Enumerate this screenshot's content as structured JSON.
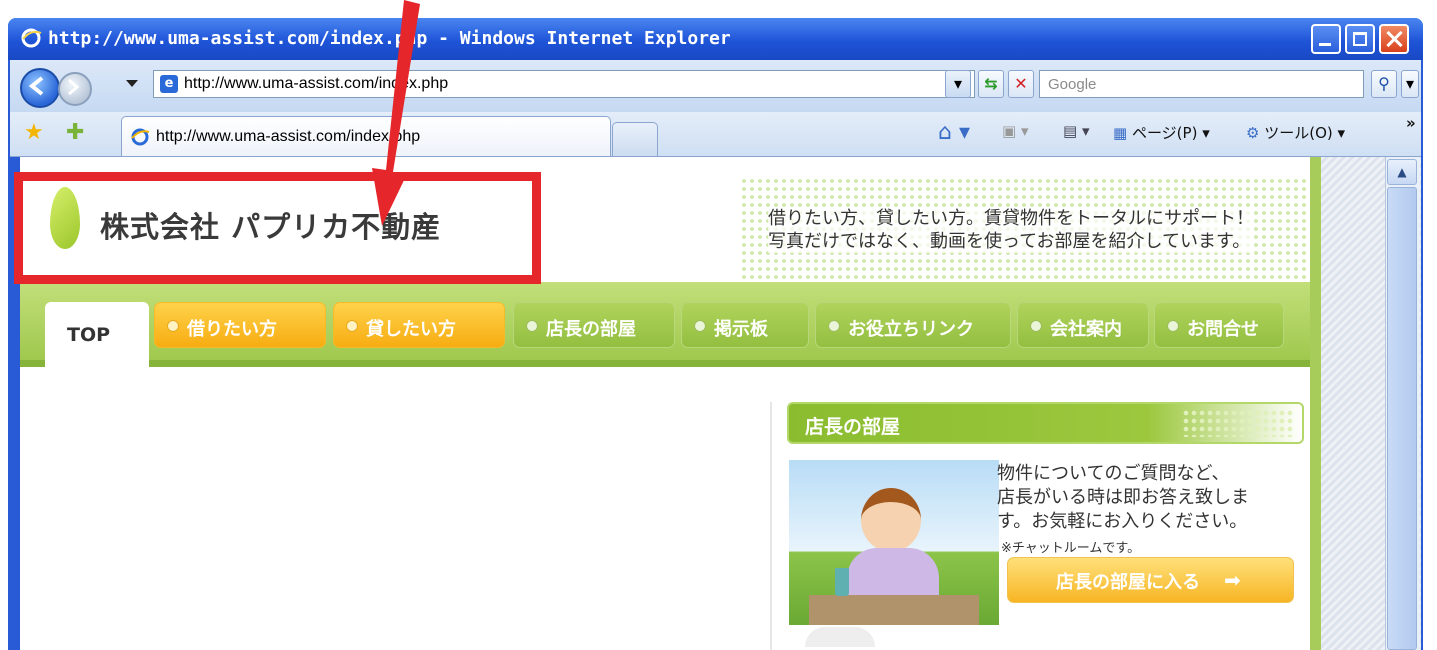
{
  "window": {
    "title": "http://www.uma-assist.com/index.php - Windows Internet Explorer"
  },
  "toolbar": {
    "address": "http://www.uma-assist.com/index.php",
    "search_placeholder": "Google",
    "tab_title": "http://www.uma-assist.com/index.php",
    "page_menu": "ページ(P)",
    "tools_menu": "ツール(O)"
  },
  "site": {
    "company_name": "株式会社 パプリカ不動産",
    "tagline_line1": "借りたい方、貸したい方。賃貸物件をトータルにサポート！",
    "tagline_line2": "写真だけではなく、動画を使ってお部屋を紹介しています。",
    "nav": {
      "top": "TOP",
      "items": [
        {
          "label": "借りたい方"
        },
        {
          "label": "貸したい方"
        },
        {
          "label": "店長の部屋"
        },
        {
          "label": "掲示板"
        },
        {
          "label": "お役立ちリンク"
        },
        {
          "label": "会社案内"
        },
        {
          "label": "お問合せ"
        }
      ]
    },
    "panel": {
      "title": "店長の部屋",
      "desc_line1": "物件についてのご質問など、",
      "desc_line2": "店長がいる時は即お答え致しま",
      "desc_line3": "す。お気軽にお入りください。",
      "note": "※チャットルームです。",
      "button": "店長の部屋に入る"
    }
  },
  "colors": {
    "highlight": "#e5262a",
    "nav_green": "#9dc64a",
    "nav_orange": "#f7ac12"
  }
}
